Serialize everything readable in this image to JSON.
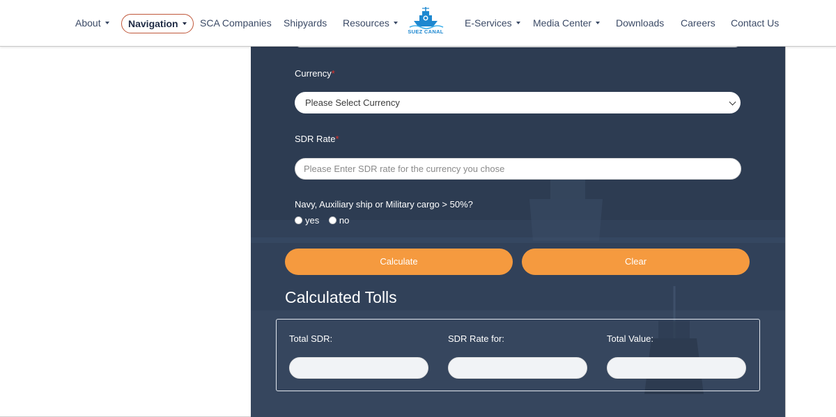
{
  "nav": {
    "items": [
      {
        "label": "About",
        "has_dropdown": true
      },
      {
        "label": "Navigation",
        "has_dropdown": true,
        "active": true
      },
      {
        "label": "SCA Companies",
        "has_dropdown": false
      },
      {
        "label": "Shipyards",
        "has_dropdown": false
      },
      {
        "label": "Resources",
        "has_dropdown": true
      },
      {
        "label": "E-Services",
        "has_dropdown": true
      },
      {
        "label": "Media Center",
        "has_dropdown": true
      },
      {
        "label": "Downloads",
        "has_dropdown": false
      },
      {
        "label": "Careers",
        "has_dropdown": false
      },
      {
        "label": "Contact Us",
        "has_dropdown": false
      }
    ],
    "logo_text": "SUEZ CANAL",
    "active_color": "#c0573a"
  },
  "form": {
    "currency": {
      "label": "Currency",
      "required_mark": "*",
      "selected": "Please Select Currency"
    },
    "sdr_rate": {
      "label": "SDR Rate",
      "required_mark": "*",
      "placeholder": "Please Enter SDR rate for the currency you chose",
      "value": ""
    },
    "navy_question": {
      "label": "Navy, Auxiliary ship or Military cargo > 50%?",
      "options": [
        "yes",
        "no"
      ]
    },
    "calculate_label": "Calculate",
    "clear_label": "Clear",
    "button_color": "#f59a3f"
  },
  "results": {
    "title": "Calculated Tolls",
    "total_sdr_label": "Total SDR:",
    "sdr_rate_for_label": "SDR Rate for:",
    "total_value_label": "Total Value:",
    "total_sdr_value": "",
    "sdr_rate_for_value": "",
    "total_value_value": ""
  },
  "colors": {
    "panel_bg": "#2d3c52",
    "nav_text": "#3b4a66",
    "required": "#e0322b"
  }
}
